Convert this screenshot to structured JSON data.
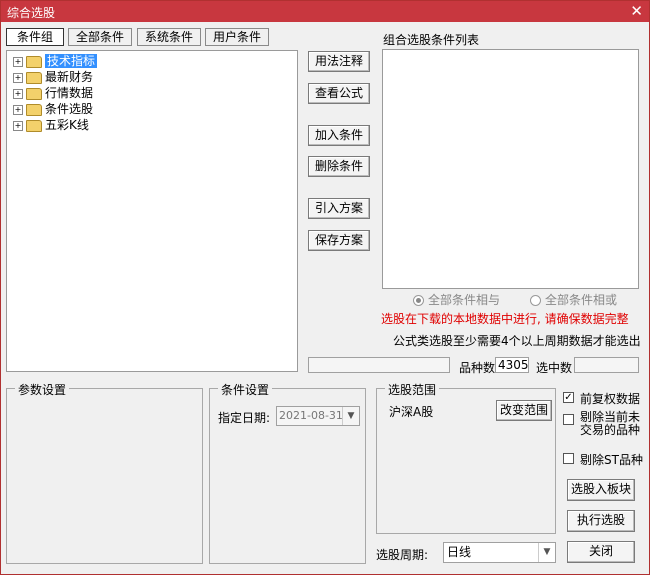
{
  "window": {
    "title": "综合选股",
    "close_glyph": "✕"
  },
  "tabs": [
    "条件组",
    "全部条件",
    "系统条件",
    "用户条件"
  ],
  "tree": [
    {
      "label": "技术指标",
      "selected": true
    },
    {
      "label": "最新财务",
      "selected": false
    },
    {
      "label": "行情数据",
      "selected": false
    },
    {
      "label": "条件选股",
      "selected": false
    },
    {
      "label": "五彩K线",
      "selected": false
    }
  ],
  "mid_buttons": [
    "用法注释",
    "查看公式",
    "加入条件",
    "删除条件",
    "引入方案",
    "保存方案"
  ],
  "right": {
    "list_title": "组合选股条件列表",
    "radio_and": "全部条件相与",
    "radio_or": "全部条件相或",
    "warning": "选股在下载的本地数据中进行, 请确保数据完整",
    "note": "公式类选股至少需要4个以上周期数据才能选出",
    "count_label": "品种数",
    "count_value": "4305",
    "selected_label": "选中数",
    "selected_value": ""
  },
  "params": {
    "title": "参数设置"
  },
  "condition": {
    "title": "条件设置",
    "date_label": "指定日期:",
    "date_value": "2021-08-31"
  },
  "scope": {
    "title": "选股范围",
    "value": "沪深A股",
    "change_button": "改变范围"
  },
  "period": {
    "label": "选股周期:",
    "value": "日线"
  },
  "options": {
    "restored": {
      "label": "前复权数据",
      "checked": true
    },
    "exclude_halted": {
      "label": "剔除当前未交易的品种",
      "checked": false
    },
    "exclude_st": {
      "label": "剔除ST品种",
      "checked": false
    }
  },
  "actions": {
    "to_sector": "选股入板块",
    "run": "执行选股",
    "close": "关闭"
  },
  "colors": {
    "titlebar": "#c8373f",
    "warning": "#e00000",
    "selection": "#3390ff"
  }
}
